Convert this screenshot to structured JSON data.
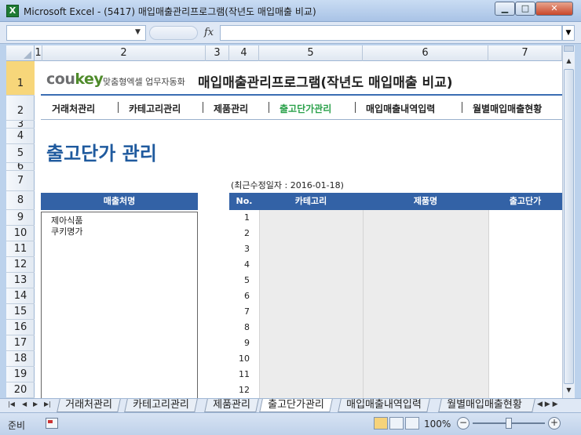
{
  "window": {
    "title": "Microsoft Excel - (5417) 매입매출관리프로그램(작년도 매입매출 비교)",
    "app_icon": "X",
    "minimize_icon": "minimize-icon",
    "maximize_icon": "maximize-icon",
    "close_icon": "close-icon"
  },
  "formula_bar": {
    "name_box": "",
    "fx": "fx",
    "formula": ""
  },
  "columns": [
    "1",
    "2",
    "3",
    "4",
    "5",
    "6",
    "7"
  ],
  "rows": [
    "1",
    "2",
    "3",
    "4",
    "5",
    "6",
    "7",
    "8",
    "9",
    "10",
    "11",
    "12",
    "13",
    "14",
    "15",
    "16",
    "17",
    "18",
    "19",
    "20"
  ],
  "header": {
    "logo_co": "cou",
    "logo_key": "key",
    "tagline": "맞춤형엑셀 업무자동화",
    "title": "매입매출관리프로그램(작년도 매입매출 비교)"
  },
  "nav": {
    "items": [
      "거래처관리",
      "카테고리관리",
      "제품관리",
      "출고단가관리",
      "매입매출내역입력",
      "월별매입매출현황"
    ],
    "active_index": 3
  },
  "page_title": "출고단가 관리",
  "modified": "(최근수정일자 : 2016-01-18)",
  "customer_panel": {
    "header": "매출처명",
    "items": [
      "제아식품",
      "쿠키명가"
    ]
  },
  "table": {
    "headers": [
      "No.",
      "카테고리",
      "제품명",
      "출고단가"
    ],
    "rows": [
      "1",
      "2",
      "3",
      "4",
      "5",
      "6",
      "7",
      "8",
      "9",
      "10",
      "11",
      "12"
    ]
  },
  "sheet_tabs": {
    "items": [
      "거래처관리",
      "카테고리관리",
      "제품관리",
      "출고단가관리",
      "매입매출내역입력",
      "월별매입매출현황"
    ],
    "active_index": 3
  },
  "status": {
    "ready": "준비",
    "zoom": "100%",
    "zoom_minus": "−",
    "zoom_plus": "+"
  }
}
